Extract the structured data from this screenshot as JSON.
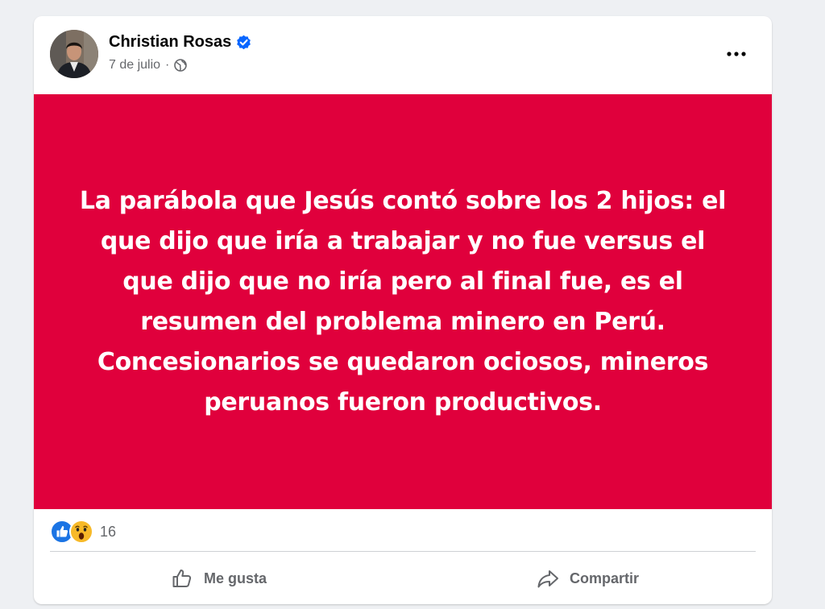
{
  "post": {
    "author": "Christian Rosas",
    "date": "7 de julio",
    "dot": "·",
    "background_color": "#e0003c",
    "text": "La parábola que Jesús contó sobre los 2 hijos: el que dijo que iría a trabajar y no fue versus el que dijo que no iría pero al final fue, es el resumen del problema minero en Perú. Concesionarios se quedaron ociosos, mineros peruanos fueron productivos."
  },
  "reactions": {
    "icons": [
      "like-icon",
      "wow-icon"
    ],
    "count": "16"
  },
  "actions": {
    "like_label": "Me gusta",
    "share_label": "Compartir"
  },
  "colors": {
    "verified": "#0866ff",
    "like": "#1b74e4",
    "wow": "#f7b928"
  }
}
